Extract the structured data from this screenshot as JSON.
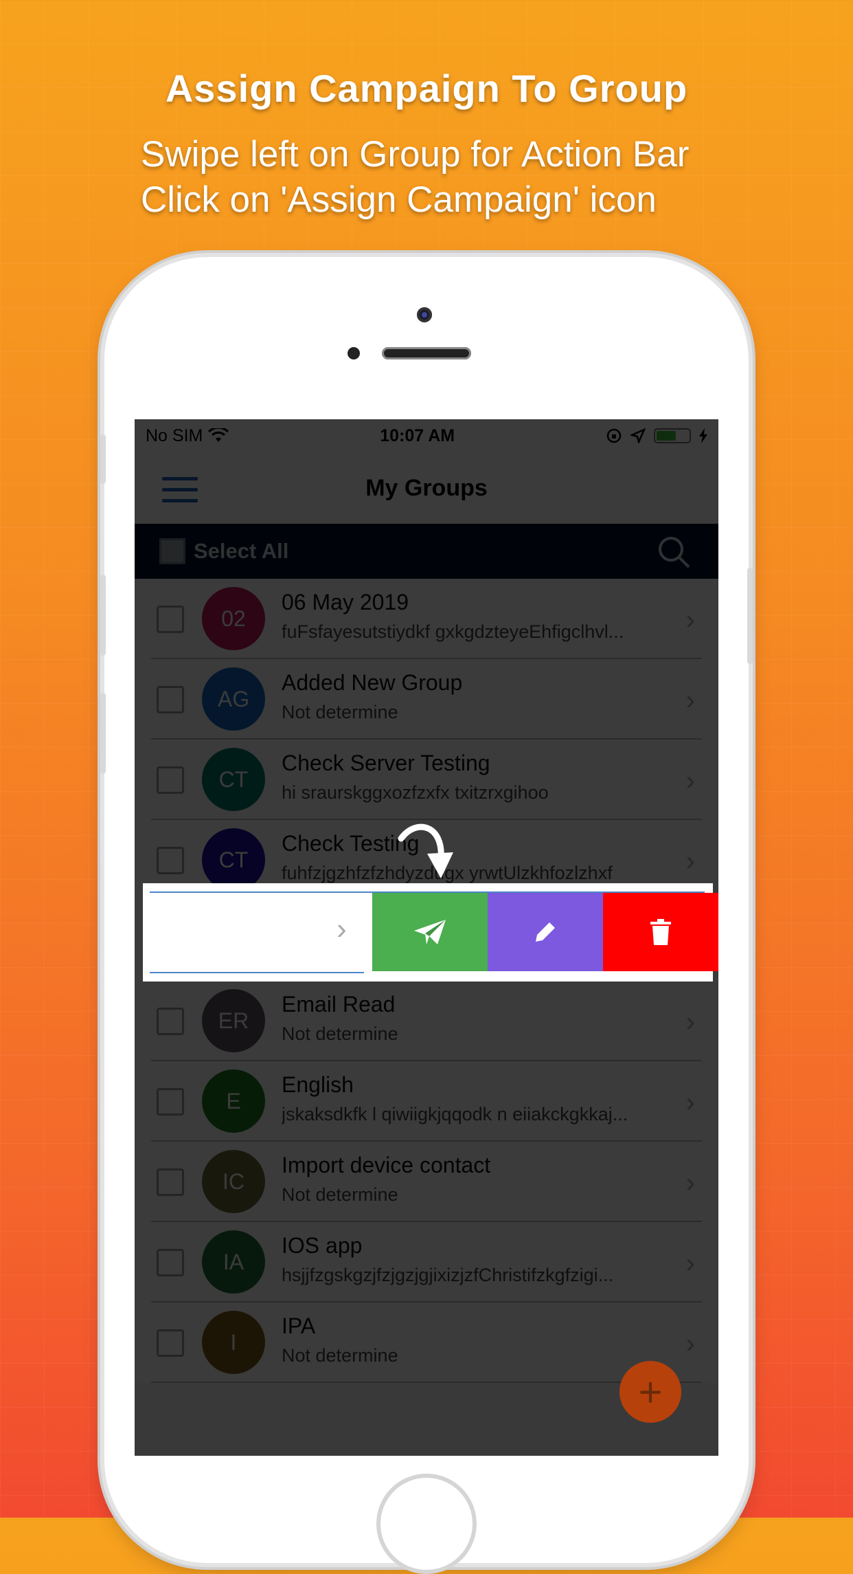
{
  "promo": {
    "headline": "Assign Campaign To Group",
    "line1": "Swipe left on Group for Action Bar",
    "line2": "Click on 'Assign Campaign' icon"
  },
  "status_bar": {
    "carrier": "No SIM",
    "time": "10:07 AM"
  },
  "nav": {
    "title": "My Groups"
  },
  "select_bar": {
    "label": "Select All"
  },
  "groups": [
    {
      "initials": "02",
      "name": "06 May 2019",
      "subtitle": "fuFsfayesutstiydkf gxkgdzteyeEhfigclhvl...",
      "color": "#c2185b"
    },
    {
      "initials": "AG",
      "name": "Added New Group",
      "subtitle": "Not determine",
      "color": "#1565c0"
    },
    {
      "initials": "CT",
      "name": "Check Server Testing",
      "subtitle": "hi sraurskggxozfzxfx txitzrxgihoo",
      "color": "#00796b"
    },
    {
      "initials": "CT",
      "name": "Check Testing",
      "subtitle": "fuhfzjgzhfzfzhdyzdugx yrwtUlzkhfozlzhxf",
      "color": "#1a0fa8"
    },
    {
      "initials": "",
      "name": "",
      "subtitle": "",
      "color": "#ffffff"
    },
    {
      "initials": "ER",
      "name": "Email Read",
      "subtitle": "Not determine",
      "color": "#5e5566"
    },
    {
      "initials": "E",
      "name": "English",
      "subtitle": "jskaksdkfk l qiwiigkjqqodk n eiiakckgkkaj...",
      "color": "#1b7a1b"
    },
    {
      "initials": "IC",
      "name": "Import device contact",
      "subtitle": "Not determine",
      "color": "#6b6a3a"
    },
    {
      "initials": "IA",
      "name": "IOS app",
      "subtitle": "hsjjfzgskgzjfzjgzjgjixizjzfChristifzkgfzigi...",
      "color": "#1e6b3a"
    },
    {
      "initials": "I",
      "name": "IPA",
      "subtitle": "Not determine",
      "color": "#7a5a18"
    }
  ],
  "actions": {
    "assign_icon": "paper-plane-icon",
    "edit_icon": "pencil-icon",
    "delete_icon": "trash-icon",
    "assign_color": "#4bae4f",
    "edit_color": "#7c59de",
    "delete_color": "#ff0000"
  },
  "fab": {
    "label": "+"
  }
}
